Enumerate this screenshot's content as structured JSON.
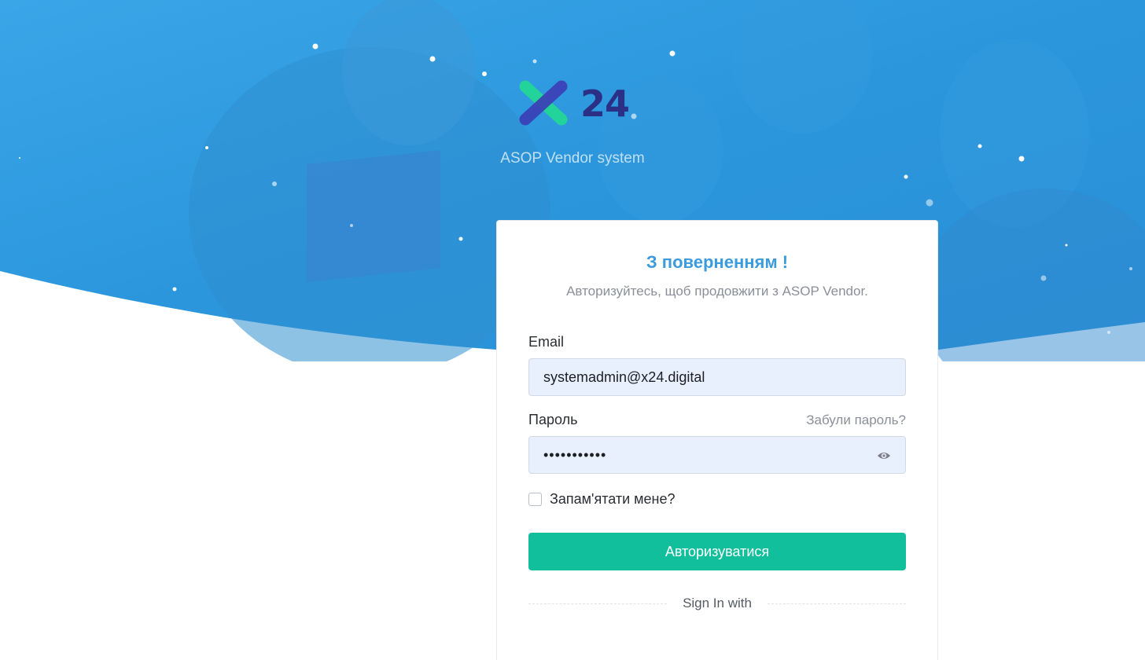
{
  "brand": {
    "logo_text": "24",
    "subtitle": "ASOP Vendor system"
  },
  "login_card": {
    "title": "З поверненням !",
    "hint": "Авторизуйтесь, щоб продовжити з ASOP Vendor.",
    "email_label": "Email",
    "email_value": "systemadmin@x24.digital",
    "password_label": "Пароль",
    "forgot_link": "Забули пароль?",
    "password_mask": "•••••••••••",
    "remember_label": "Запам'ятати мене?",
    "remember_checked": false,
    "submit_label": "Авторизуватися",
    "sign_in_with": "Sign In with"
  },
  "colors": {
    "hero_blue": "#2d9be0",
    "accent_green": "#12bf9c",
    "title_blue": "#3b9bdc",
    "logo_navy": "#2b2f86",
    "input_bg": "#e8effd"
  },
  "icons": {
    "password_toggle": "eye-icon",
    "logo": "x24-logo-icon"
  }
}
